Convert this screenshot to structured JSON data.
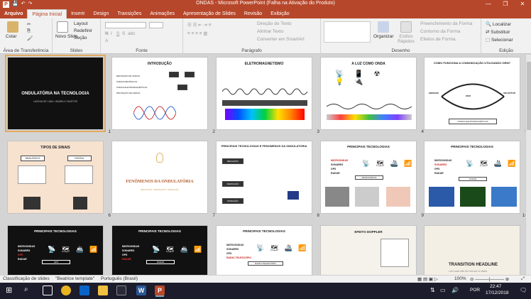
{
  "window": {
    "title": "ONDAS - Microsoft PowerPoint (Falha na Ativação do Produto)",
    "controls": [
      "—",
      "❐",
      "✕"
    ]
  },
  "tabs": [
    {
      "label": "Arquivo"
    },
    {
      "label": "Página Inicial"
    },
    {
      "label": "Inserir"
    },
    {
      "label": "Design"
    },
    {
      "label": "Transições"
    },
    {
      "label": "Animações"
    },
    {
      "label": "Apresentação de Slides"
    },
    {
      "label": "Revisão"
    },
    {
      "label": "Exibição"
    }
  ],
  "ribbon": {
    "clipboard": {
      "label": "Área de Transferência",
      "paste": "Colar"
    },
    "slides": {
      "label": "Slides",
      "new_slide": "Novo Slide",
      "layout": "Layout",
      "reset": "Redefinir",
      "section": "Seção"
    },
    "font": {
      "label": "Fonte"
    },
    "paragraph": {
      "label": "Parágrafo",
      "text_direction": "Direção do Texto",
      "align_text": "Alinhar Texto",
      "smartart": "Converter em SmartArt"
    },
    "drawing": {
      "label": "Desenho",
      "arrange": "Organizar",
      "quick_styles": "Estilos Rápidos",
      "fill": "Preenchimento da Forma",
      "outline": "Contorno da Forma",
      "effects": "Efeitos de Forma"
    },
    "editing": {
      "label": "Edição",
      "find": "Localizar",
      "replace": "Substituir",
      "select": "Selecionar"
    }
  },
  "slides": [
    {
      "number": "1",
      "title": "ONDULATÓRIA NA TECNOLOGIA",
      "subtitle": "LAVÍNIA DE LIMA • ISABELLY BASTOS",
      "theme": "dark"
    },
    {
      "number": "2",
      "title": "INTRODUÇÃO",
      "bullets": [
        "DEFINIÇÃO DE ONDAS",
        "ONDAS MECÂNICAS",
        "ONDAS ELETROMAGNÉTICAS",
        "PROTEÇÃO DE ONDAS"
      ],
      "theme": "light"
    },
    {
      "number": "3",
      "title": "ELETROMAGNETISMO",
      "theme": "light"
    },
    {
      "number": "4",
      "title": "A LUZ COMO ONDA",
      "theme": "light"
    },
    {
      "number": "5",
      "title": "COMO FUNCIONA A COMUNICAÇÃO UTILIZANDO OEM?",
      "labels": [
        "EMISSOR",
        "RECEPTOR",
        "OEM",
        "ONDAS ELETROMAGNÉTICAS"
      ],
      "theme": "light"
    },
    {
      "number": "6",
      "title": "TIPOS DE SINAIS",
      "labels": [
        "ANALÓGICO",
        "DIGITAL"
      ],
      "theme": "beige"
    },
    {
      "number": "7",
      "title": "FENÔMENOS DA ONDULATÓRIA",
      "subtitle": "REFLEXÃO • REFRAÇÃO • DIFRAÇÃO",
      "theme": "light"
    },
    {
      "number": "8",
      "title": "PRINCIPAIS TECNOLOGIAS E FENOMENOS DA ONDULATORIA",
      "labels": [
        "REFLEXÃO",
        "REFRAÇÃO",
        "DIFRAÇÃO"
      ],
      "theme": "light"
    },
    {
      "number": "9",
      "title": "PRINCIPAIS TECNOLOGIAS",
      "bullets": [
        "MICROONDAS",
        "SONARES",
        "GPS",
        "RADAR"
      ],
      "box": "MICROONDAS",
      "theme": "light"
    },
    {
      "number": "10",
      "title": "PRINCIPAIS TECNOLOGIAS",
      "bullets": [
        "MICROONDAS",
        "SONARES",
        "GPS",
        "RADAR"
      ],
      "box": "SONAR",
      "theme": "light"
    },
    {
      "number": "11",
      "title": "PRINCIPAIS TECNOLOGIAS",
      "bullets": [
        "MICROONDAS",
        "SONARES",
        "GPS",
        "RADAR"
      ],
      "box": "GPS",
      "theme": "dark"
    },
    {
      "number": "12",
      "title": "PRINCIPAIS TECNOLOGIAS",
      "bullets": [
        "MICROONDAS",
        "SONARES",
        "GPS",
        "RADAR"
      ],
      "box": "RADAR",
      "theme": "dark"
    },
    {
      "number": "13",
      "title": "PRINCIPAIS TECNOLOGIAS",
      "bullets": [
        "MICROONDAS",
        "SONARES",
        "GPS",
        "RADIO-TELESCÓPIO"
      ],
      "box": "RADIO-TELESCÓPIO",
      "theme": "light"
    },
    {
      "number": "14",
      "title": "EFEITO DOPPLER",
      "theme": "light"
    },
    {
      "number": "15",
      "title": "TRANSITION HEADLINE",
      "subtitle": "Let's start with the first set of slides",
      "theme": "light"
    }
  ],
  "statusbar": {
    "view": "Classificação de slides",
    "theme": "\"Beatrice template\"",
    "language": "Português (Brasil)",
    "zoom": "100%"
  },
  "taskbar": {
    "lang": "POR",
    "time": "22:47",
    "date": "17/12/2018"
  },
  "colors": {
    "accent": "#b7472a",
    "selection": "#e1a95f",
    "taskbar": "#1c1c2c"
  }
}
